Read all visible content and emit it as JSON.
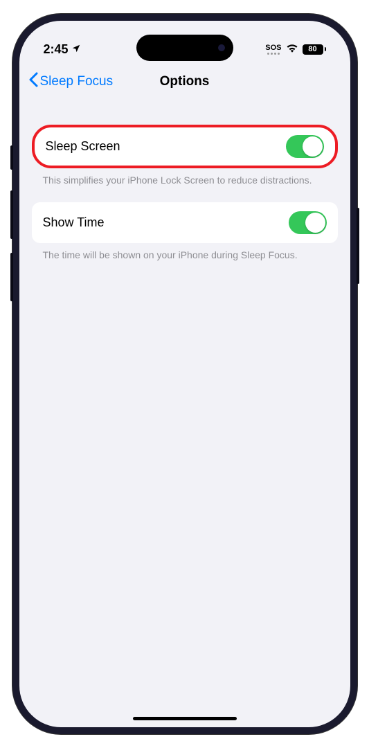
{
  "status": {
    "time": "2:45",
    "sos": "SOS",
    "battery": "80"
  },
  "nav": {
    "back": "Sleep Focus",
    "title": "Options"
  },
  "settings": [
    {
      "label": "Sleep Screen",
      "description": "This simplifies your iPhone Lock Screen to reduce distractions.",
      "on": true,
      "highlighted": true
    },
    {
      "label": "Show Time",
      "description": "The time will be shown on your iPhone during Sleep Focus.",
      "on": true,
      "highlighted": false
    }
  ]
}
